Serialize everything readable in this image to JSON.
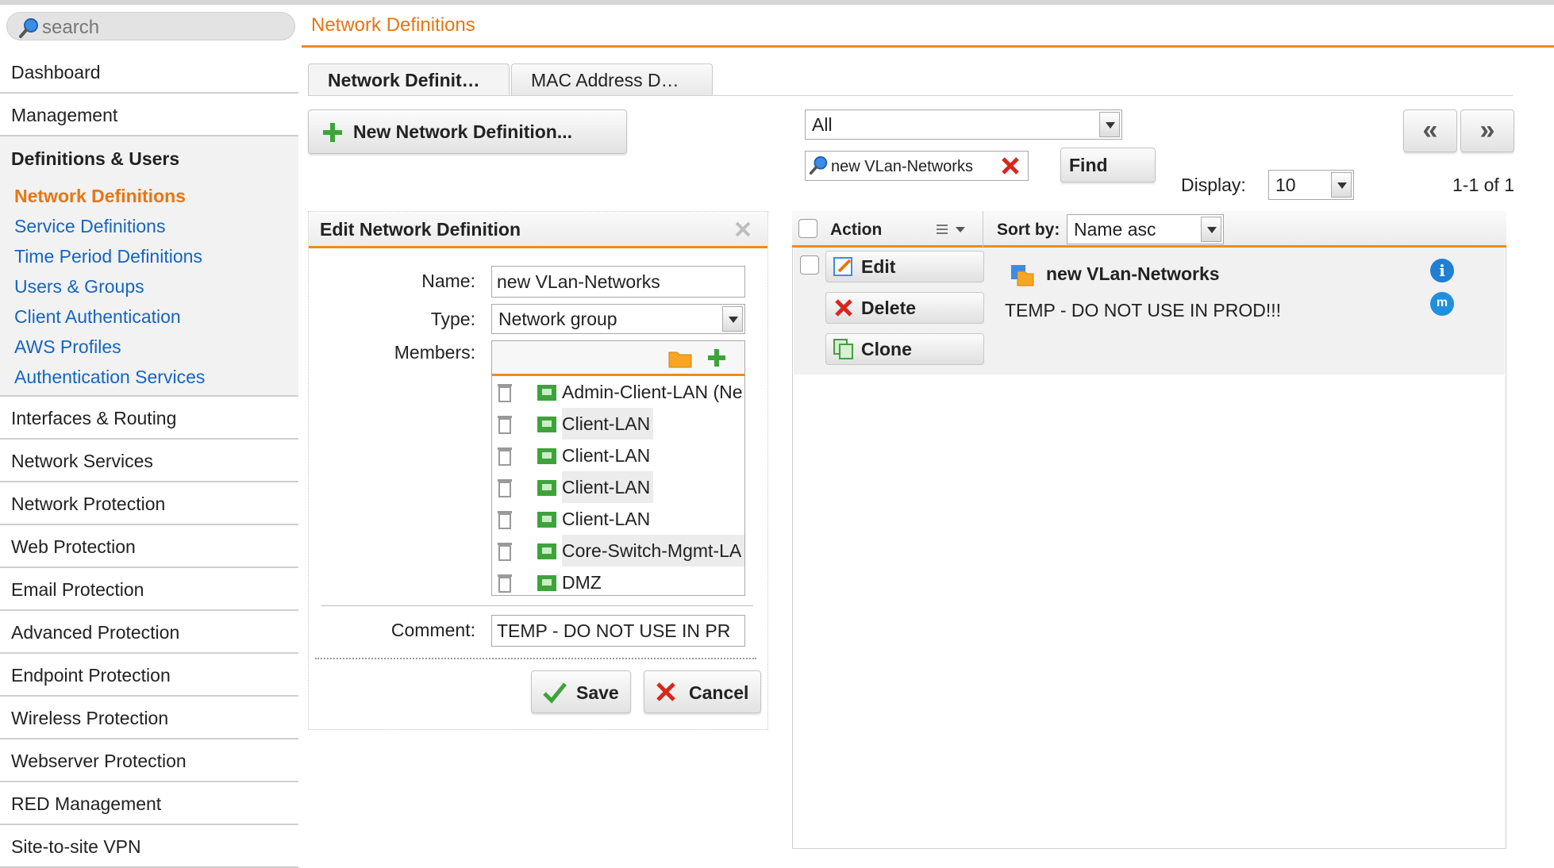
{
  "search": {
    "placeholder": "search"
  },
  "page_title": "Network Definitions",
  "sidebar": {
    "items_top": [
      {
        "label": "Dashboard"
      },
      {
        "label": "Management"
      }
    ],
    "section": "Definitions & Users",
    "sub_items": [
      {
        "label": "Network Definitions"
      },
      {
        "label": "Service Definitions"
      },
      {
        "label": "Time Period Definitions"
      },
      {
        "label": "Users & Groups"
      },
      {
        "label": "Client Authentication"
      },
      {
        "label": "AWS Profiles"
      },
      {
        "label": "Authentication Services"
      }
    ],
    "items_bottom": [
      {
        "label": "Interfaces & Routing"
      },
      {
        "label": "Network Services"
      },
      {
        "label": "Network Protection"
      },
      {
        "label": "Web Protection"
      },
      {
        "label": "Email Protection"
      },
      {
        "label": "Advanced Protection"
      },
      {
        "label": "Endpoint Protection"
      },
      {
        "label": "Wireless Protection"
      },
      {
        "label": "Webserver Protection"
      },
      {
        "label": "RED Management"
      },
      {
        "label": "Site-to-site VPN"
      }
    ]
  },
  "tabs": [
    {
      "label": "Network Definit…"
    },
    {
      "label": "MAC Address D…"
    }
  ],
  "new_button": "New Network Definition...",
  "edit_panel": {
    "title": "Edit Network Definition",
    "name_label": "Name:",
    "name_value": "new VLan-Networks",
    "type_label": "Type:",
    "type_value": "Network group",
    "members_label": "Members:",
    "members": [
      {
        "name": "Admin-Client-LAN (Ne"
      },
      {
        "name": "Client-LAN"
      },
      {
        "name": "Client-LAN"
      },
      {
        "name": "Client-LAN"
      },
      {
        "name": "Client-LAN"
      },
      {
        "name": "Core-Switch-Mgmt-LA"
      },
      {
        "name": "DMZ"
      }
    ],
    "comment_label": "Comment:",
    "comment_value": "TEMP - DO NOT USE IN PR",
    "save_label": "Save",
    "cancel_label": "Cancel"
  },
  "filter": {
    "scope_value": "All",
    "search_value": "new VLan-Networks",
    "find_label": "Find",
    "display_label": "Display:",
    "display_value": "10",
    "count_text": "1-1 of 1",
    "prev_label": "«",
    "next_label": "»"
  },
  "list": {
    "action_header": "Action",
    "sort_label": "Sort by:",
    "sort_value": "Name asc",
    "edit_label": "Edit",
    "delete_label": "Delete",
    "clone_label": "Clone",
    "entry_name": "new VLan-Networks",
    "entry_comment": "TEMP - DO NOT USE IN PROD!!!",
    "info_icon_text": "i",
    "m_icon_text": "m"
  },
  "colors": {
    "accent": "#e87511",
    "link": "#1565c0",
    "net_green": "#3ea33b"
  }
}
